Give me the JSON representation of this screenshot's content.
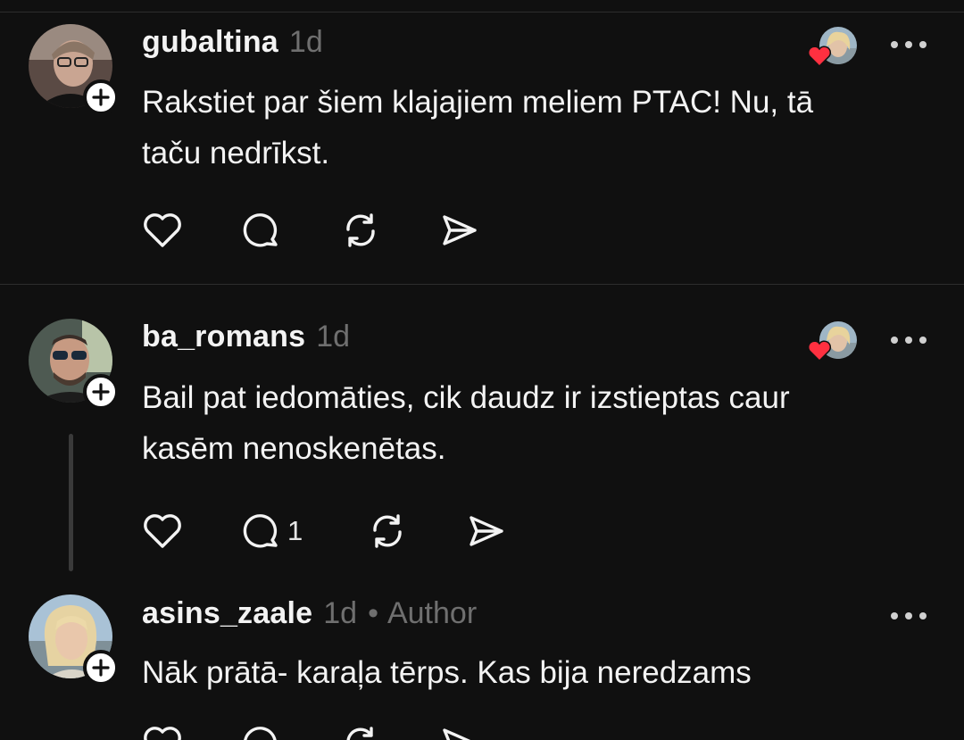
{
  "posts": [
    {
      "username": "gubaltina",
      "time": "1d",
      "text_line1": "Rakstiet par šiem klajajiem meliem PTAC! Nu, tā",
      "text_line2": "taču nedrīkst.",
      "liked_by_author": true
    },
    {
      "username": "ba_romans",
      "time": "1d",
      "text_line1": "Bail pat iedomāties, cik daudz ir izstieptas caur",
      "text_line2": "kasēm nenoskenētas.",
      "reply_count": "1",
      "liked_by_author": true
    },
    {
      "username": "asins_zaale",
      "time": "1d",
      "separator": "•",
      "author_label": "Author",
      "text_line1": "Nāk prātā- karaļa tērps. Kas bija neredzams"
    }
  ],
  "icons": {
    "like": "heart-outline-icon",
    "reply": "comment-bubble-icon",
    "repost": "repost-icon",
    "share": "send-icon",
    "more": "more-dots-icon",
    "follow": "plus-icon",
    "author_like": "heart-filled-icon"
  },
  "colors": {
    "background": "#101010",
    "text": "#f3f3f3",
    "muted": "#6f6f6f",
    "heart": "#ff3040",
    "divider": "#2d2d2d"
  }
}
